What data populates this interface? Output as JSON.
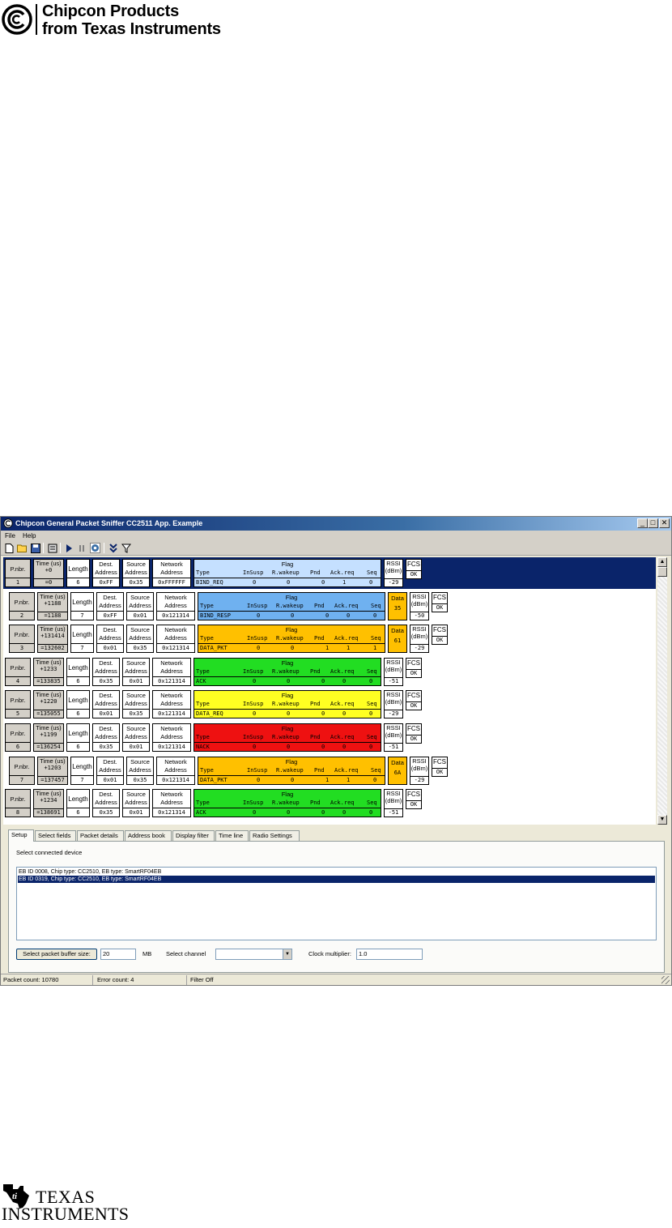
{
  "header_logo": {
    "line1": "Chipcon Products",
    "line2": "from Texas Instruments"
  },
  "footer_logo": {
    "line1": "TEXAS",
    "line2": "INSTRUMENTS"
  },
  "window": {
    "title": "Chipcon General Packet Sniffer CC2511 App. Example",
    "min_glyph": "_",
    "max_glyph": "□",
    "close_glyph": "✕"
  },
  "menu": {
    "file": "File",
    "help": "Help"
  },
  "toolbar": [
    "new-file-icon",
    "open-folder-icon",
    "save-icon",
    "clear-icon",
    "play-icon",
    "pause-icon",
    "settings-icon",
    "scroll-down-icon",
    "filter-icon"
  ],
  "labels": {
    "pnbr": "P.nbr.",
    "time": "Time (us)",
    "length": "Length",
    "dest1": "Dest.",
    "dest2": "Address",
    "src1": "Source",
    "src2": "Address",
    "net1": "Network",
    "net2": "Address",
    "flag": "Flag",
    "data": "Data",
    "rssi1": "RSSI",
    "rssi2": "(dBm)",
    "fcs": "FCS",
    "flag_cols": [
      "Type",
      "InSusp",
      "R.wakeup",
      "Pnd",
      "Ack.req",
      "Seq"
    ]
  },
  "packets": [
    {
      "nbr": "1",
      "t1": "+0",
      "t2": "=0",
      "len": "6",
      "dest": "0xFF",
      "src": "0x35",
      "net": "0xFFFFFF",
      "type": "BIND_REQ",
      "insusp": "0",
      "rwakeup": "0",
      "pnd": "0",
      "ackreq": "1",
      "seq": "0",
      "data": null,
      "rssi": "-29",
      "fcs": "OK",
      "color": "#c5e0ff",
      "selected": true
    },
    {
      "nbr": "2",
      "t1": "+1188",
      "t2": "=1188",
      "len": "7",
      "dest": "0xFF",
      "src": "0x01",
      "net": "0x121314",
      "type": "BIND_RESP",
      "insusp": "0",
      "rwakeup": "0",
      "pnd": "0",
      "ackreq": "0",
      "seq": "0",
      "data": "35",
      "rssi": "-50",
      "fcs": "OK",
      "color": "#6fb1f0",
      "selected": false
    },
    {
      "nbr": "3",
      "t1": "+131414",
      "t2": "=132602",
      "len": "7",
      "dest": "0x01",
      "src": "0x35",
      "net": "0x121314",
      "type": "DATA_PKT",
      "insusp": "0",
      "rwakeup": "0",
      "pnd": "1",
      "ackreq": "1",
      "seq": "1",
      "data": "61",
      "rssi": "-29",
      "fcs": "OK",
      "color": "#ffc000",
      "selected": false
    },
    {
      "nbr": "4",
      "t1": "+1233",
      "t2": "=133835",
      "len": "6",
      "dest": "0x35",
      "src": "0x01",
      "net": "0x121314",
      "type": "ACK",
      "insusp": "0",
      "rwakeup": "0",
      "pnd": "0",
      "ackreq": "0",
      "seq": "0",
      "data": null,
      "rssi": "-51",
      "fcs": "OK",
      "color": "#22dd22",
      "selected": false
    },
    {
      "nbr": "5",
      "t1": "+1220",
      "t2": "=135055",
      "len": "6",
      "dest": "0x01",
      "src": "0x35",
      "net": "0x121314",
      "type": "DATA_REQ",
      "insusp": "0",
      "rwakeup": "0",
      "pnd": "0",
      "ackreq": "0",
      "seq": "0",
      "data": null,
      "rssi": "-29",
      "fcs": "OK",
      "color": "#ffff22",
      "selected": false
    },
    {
      "nbr": "6",
      "t1": "+1199",
      "t2": "=136254",
      "len": "6",
      "dest": "0x35",
      "src": "0x01",
      "net": "0x121314",
      "type": "NACK",
      "insusp": "0",
      "rwakeup": "0",
      "pnd": "0",
      "ackreq": "0",
      "seq": "0",
      "data": null,
      "rssi": "-51",
      "fcs": "OK",
      "color": "#ee1111",
      "selected": false
    },
    {
      "nbr": "7",
      "t1": "+1203",
      "t2": "=137457",
      "len": "7",
      "dest": "0x01",
      "src": "0x35",
      "net": "0x121314",
      "type": "DATA_PKT",
      "insusp": "0",
      "rwakeup": "0",
      "pnd": "1",
      "ackreq": "1",
      "seq": "0",
      "data": "6A",
      "rssi": "-29",
      "fcs": "OK",
      "color": "#ffc000",
      "selected": false
    },
    {
      "nbr": "8",
      "t1": "+1234",
      "t2": "=138691",
      "len": "6",
      "dest": "0x35",
      "src": "0x01",
      "net": "0x121314",
      "type": "ACK",
      "insusp": "0",
      "rwakeup": "0",
      "pnd": "0",
      "ackreq": "0",
      "seq": "0",
      "data": null,
      "rssi": "-51",
      "fcs": "OK",
      "color": "#22dd22",
      "selected": false
    }
  ],
  "tabs": [
    "Setup",
    "Select fields",
    "Packet details",
    "Address book",
    "Display filter",
    "Time line",
    "Radio Settings"
  ],
  "setup": {
    "select_device_label": "Select connected device",
    "devices": [
      {
        "text": "EB ID 0008,   Chip type: CC2510,   EB type: SmartRF04EB",
        "selected": false
      },
      {
        "text": "EB ID 0319,   Chip type: CC2510,   EB type: SmartRF04EB",
        "selected": true
      }
    ],
    "buffer_button": "Select packet buffer size:",
    "buffer_value": "20",
    "buffer_unit": "MB",
    "channel_label": "Select channel",
    "channel_value": "",
    "clock_label": "Clock multiplier:",
    "clock_value": "1.0"
  },
  "status": {
    "packet_count": "Packet count: 10780",
    "error_count": "Error count: 4",
    "filter": "Filter Off"
  }
}
